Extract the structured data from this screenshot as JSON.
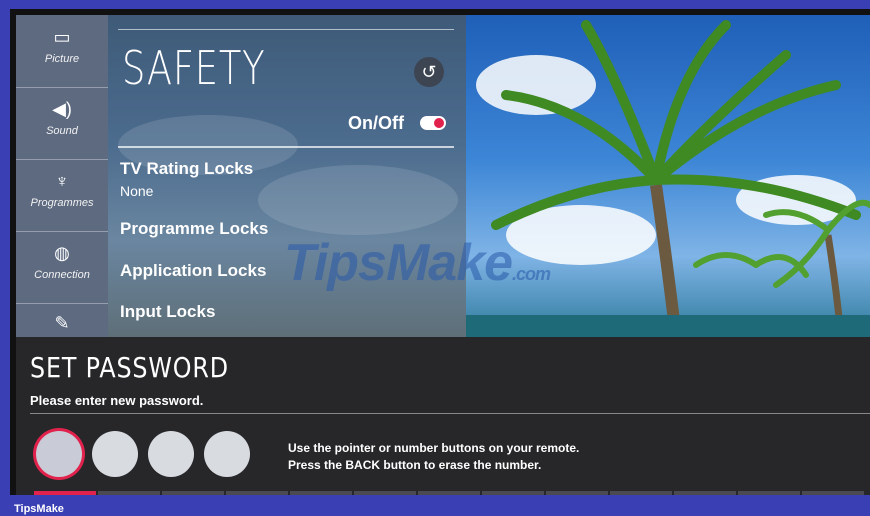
{
  "sidebar": {
    "items": [
      {
        "label": "Picture",
        "icon": "picture-icon"
      },
      {
        "label": "Sound",
        "icon": "speaker-icon"
      },
      {
        "label": "Programmes",
        "icon": "antenna-icon"
      },
      {
        "label": "Connection",
        "icon": "globe-icon"
      },
      {
        "label": "",
        "icon": "wrench-icon"
      }
    ]
  },
  "safety": {
    "title": "SAFETY",
    "onoff_label": "On/Off",
    "toggle_on": true,
    "items": [
      {
        "label": "TV Rating Locks",
        "value": "None"
      },
      {
        "label": "Programme Locks"
      },
      {
        "label": "Application Locks"
      },
      {
        "label": "Input Locks"
      }
    ]
  },
  "password": {
    "title": "SET PASSWORD",
    "subtitle": "Please enter new password.",
    "hint1": "Use the pointer or number buttons on your remote.",
    "hint2": "Press the BACK button to erase the number.",
    "digits_entered": 0,
    "digit_count": 4
  },
  "watermark": {
    "text": "TipsMake",
    "suffix": ".com"
  },
  "footer": {
    "brand": "TipsMake"
  },
  "colors": {
    "accent": "#e0224c",
    "frame": "#3b3fb4"
  }
}
